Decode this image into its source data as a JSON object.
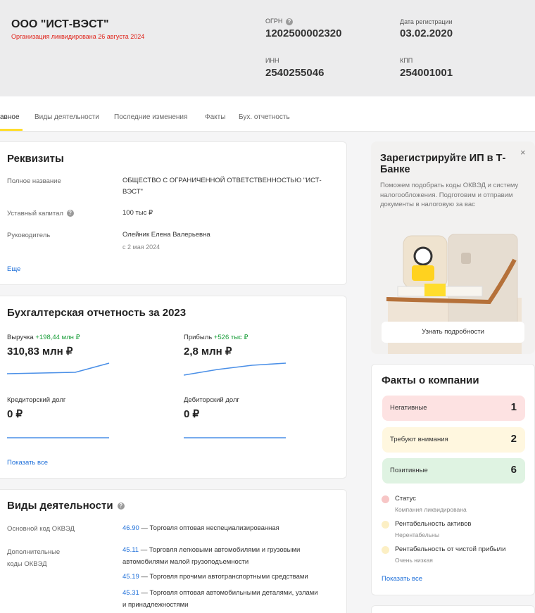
{
  "header": {
    "company_name": "ООО \"ИСТ-ВЭСТ\"",
    "status": "Организация ликвидирована 26 августа 2024",
    "ogrn_label": "ОГРН",
    "ogrn_value": "1202500002320",
    "reg_date_label": "Дата регистрации",
    "reg_date_value": "03.02.2020",
    "inn_label": "ИНН",
    "inn_value": "2540255046",
    "kpp_label": "КПП",
    "kpp_value": "254001001"
  },
  "tabs": [
    {
      "label": "авное"
    },
    {
      "label": "Виды деятельности"
    },
    {
      "label": "Последние изменения"
    },
    {
      "label": "Факты"
    },
    {
      "label": "Бух. отчетность"
    }
  ],
  "requisites": {
    "title": "Реквизиты",
    "full_name_label": "Полное название",
    "full_name_line1": "ОБЩЕСТВО С ОГРАНИЧЕННОЙ ОТВЕТСТВЕННОСТЬЮ \"ИСТ-",
    "full_name_line2": "ВЭСТ\"",
    "capital_label": "Уставный капитал",
    "capital_value": "100 тыс ₽",
    "head_label": "Руководитель",
    "head_value": "Олейник Елена Валерьевна",
    "head_since": "с 2 мая 2024",
    "more_link": "Еще"
  },
  "accounting": {
    "title": "Бухгалтерская отчетность за 2023",
    "revenue_label": "Выручка",
    "revenue_delta": "+198,44 млн ₽",
    "revenue_value": "310,83 млн ₽",
    "profit_label": "Прибыль",
    "profit_delta": "+526 тыс ₽",
    "profit_value": "2,8 млн ₽",
    "creditor_label": "Кредиторский долг",
    "creditor_value": "0 ₽",
    "debtor_label": "Дебиторский долг",
    "debtor_value": "0 ₽",
    "show_all": "Показать все",
    "line_color": "#4a8fe7"
  },
  "activities": {
    "title": "Виды деятельности",
    "main_label": "Основной код ОКВЭД",
    "main_code": "46.90",
    "main_text": " — Торговля оптовая неспециализированная",
    "extra_label_line1": "Дополнительные",
    "extra_label_line2": "коды ОКВЭД",
    "extra": [
      {
        "code": "45.11",
        "line1": " — Торговля легковыми автомобилями и грузовыми",
        "line2": "автомобилями малой грузоподъемности"
      },
      {
        "code": "45.19",
        "line1": " — Торговля прочими автотранспортными средствами",
        "line2": ""
      },
      {
        "code": "45.31",
        "line1": " — Торговля оптовая автомобильными деталями, узлами",
        "line2": "и принадлежностями"
      }
    ]
  },
  "promo": {
    "title": "Зарегистрируйте ИП в Т-Банке",
    "text": "Поможем подобрать коды ОКВЭД и систему налогообложения. Подготовим и отправим документы в налоговую за вас",
    "close": "×",
    "button": "Узнать подробности"
  },
  "facts": {
    "title": "Факты о компании",
    "pills": [
      {
        "label": "Негативные",
        "count": "1",
        "color": "#fde2e2"
      },
      {
        "label": "Требуют внимания",
        "count": "2",
        "color": "#fff7df"
      },
      {
        "label": "Позитивные",
        "count": "6",
        "color": "#dff3e2"
      }
    ],
    "items": [
      {
        "title": "Статус",
        "sub": "Компания ликвидирована",
        "color": "#f7c6c6"
      },
      {
        "title": "Рентабельность активов",
        "sub": "Нерентабельны",
        "color": "#fcefc4"
      },
      {
        "title": "Рентабельность от чистой прибыли",
        "sub": "Очень низкая",
        "color": "#fcefc4"
      }
    ],
    "show_all": "Показать все"
  },
  "colors": {
    "accent_tab": "#ffdd2d",
    "link": "#1e6fd9",
    "liquidated": "#e0241b",
    "positive_delta": "#1a9e3a"
  }
}
